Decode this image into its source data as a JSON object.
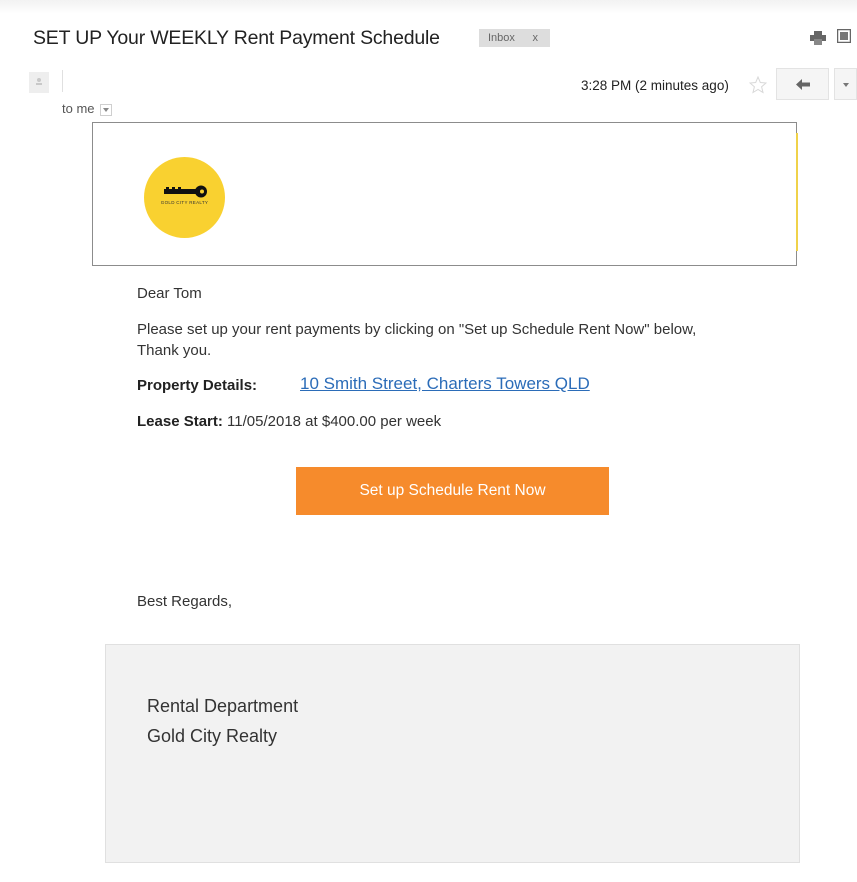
{
  "email": {
    "subject": "SET UP Your WEEKLY Rent Payment Schedule",
    "label": "Inbox",
    "label_close": "x",
    "recipient": "to me",
    "time": "3:28 PM (2 minutes ago)"
  },
  "icons": {
    "print": "print-icon",
    "new_window": "new-window-icon",
    "avatar": "person-icon",
    "star": "star-icon",
    "reply": "reply-arrow-icon",
    "more": "chevron-down-icon"
  },
  "logo": {
    "text": "GOLD CITY REALTY",
    "color": "#f9d130"
  },
  "message": {
    "greeting": "Dear Tom",
    "paragraph": "Please set up your rent payments by clicking on \"Set up Schedule Rent Now\" below, Thank you.",
    "property_label": "Property Details:",
    "property_address": "10 Smith Street, Charters Towers QLD",
    "lease_label": "Lease Start:",
    "lease_value": "11/05/2018 at $400.00 per week",
    "cta_label": "Set up Schedule Rent Now",
    "closing": "Best Regards,"
  },
  "signature": {
    "line1": "Rental Department",
    "line2": "Gold City Realty"
  },
  "colors": {
    "cta": "#f68b2c",
    "link": "#2b6cb8",
    "logo_yellow": "#f9d130"
  }
}
